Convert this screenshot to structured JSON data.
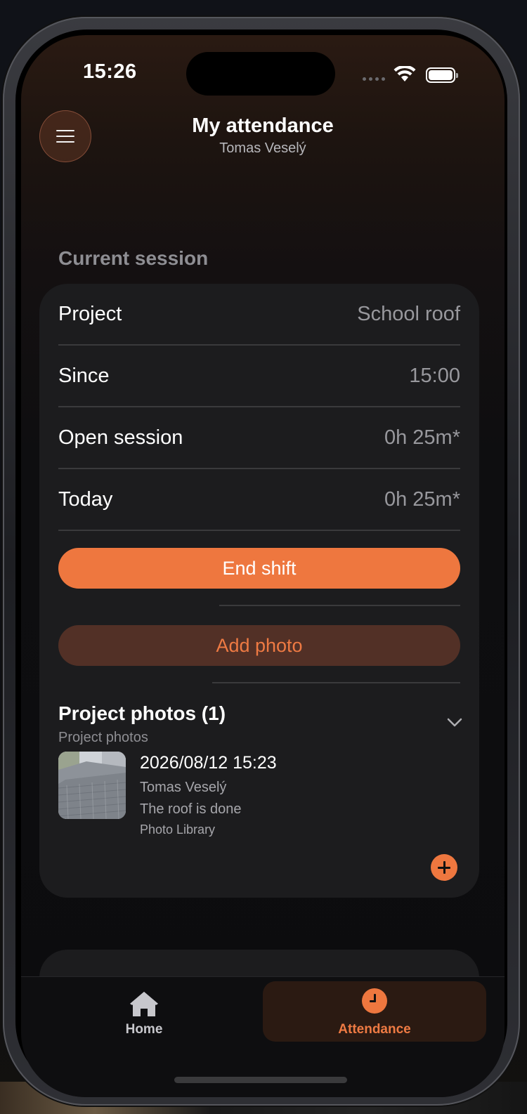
{
  "status_bar": {
    "time": "15:26"
  },
  "header": {
    "title": "My attendance",
    "subtitle": "Tomas Veselý",
    "menu_icon": "hamburger-menu-icon"
  },
  "current_session": {
    "section_title": "Current session",
    "rows": [
      {
        "label": "Project",
        "value": "School roof"
      },
      {
        "label": "Since",
        "value": "15:00"
      },
      {
        "label": "Open session",
        "value": "0h 25m*"
      },
      {
        "label": "Today",
        "value": "0h 25m*"
      }
    ],
    "end_shift_label": "End shift",
    "add_photo_label": "Add photo"
  },
  "project_photos": {
    "title": "Project photos (1)",
    "subtitle": "Project photos",
    "items": [
      {
        "date": "2026/08/12 15:23",
        "author": "Tomas Veselý",
        "caption": "The roof is done",
        "source": "Photo Library"
      }
    ]
  },
  "tab_bar": {
    "tabs": [
      {
        "label": "Home",
        "icon": "house-icon",
        "selected": false
      },
      {
        "label": "Attendance",
        "icon": "clock-icon",
        "selected": true
      }
    ]
  },
  "colors": {
    "accent": "#ee773f",
    "card_background": "#1c1c1e",
    "secondary_button_background": "#523026"
  }
}
